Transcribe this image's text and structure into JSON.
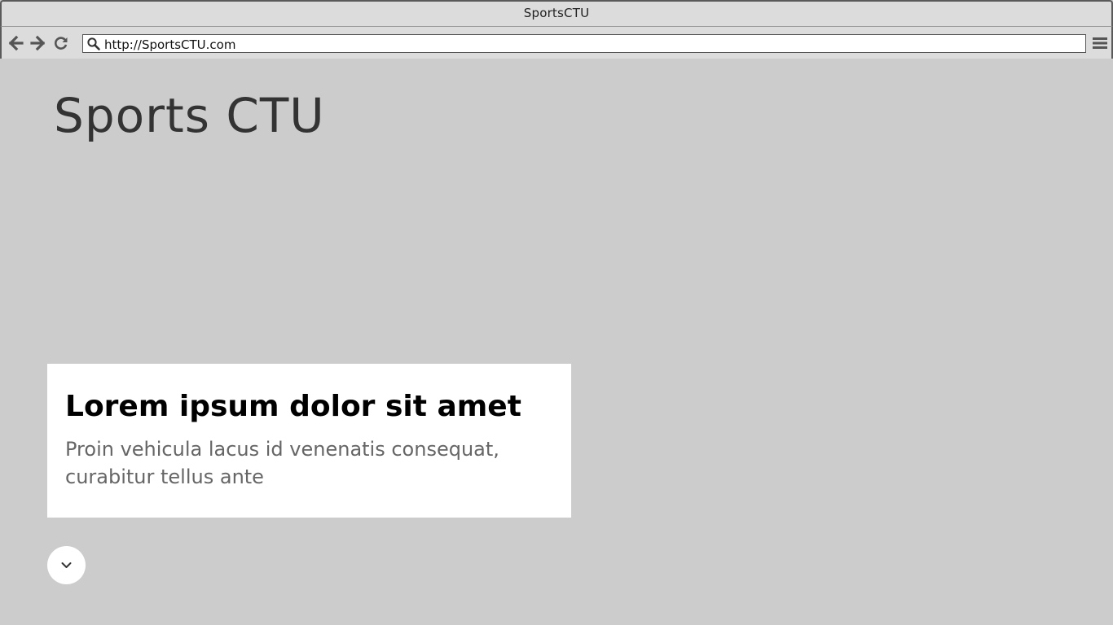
{
  "window": {
    "title": "SportsCTU"
  },
  "toolbar": {
    "url": "http://SportsCTU.com",
    "icons": {
      "back": "arrow-left-icon",
      "forward": "arrow-right-icon",
      "reload": "reload-icon",
      "search": "search-icon",
      "menu": "hamburger-menu-icon"
    }
  },
  "page": {
    "site_title": "Sports CTU",
    "hero": {
      "heading": "Lorem ipsum dolor sit amet",
      "text": "Proin vehicula lacus id venenatis consequat, curabitur tellus ante"
    },
    "scroll_icon": "chevron-down-icon"
  },
  "colors": {
    "background": "#cccccc",
    "chrome": "#dcdcdc",
    "card": "#ffffff",
    "title_text": "#333333",
    "body_text": "#666666"
  }
}
